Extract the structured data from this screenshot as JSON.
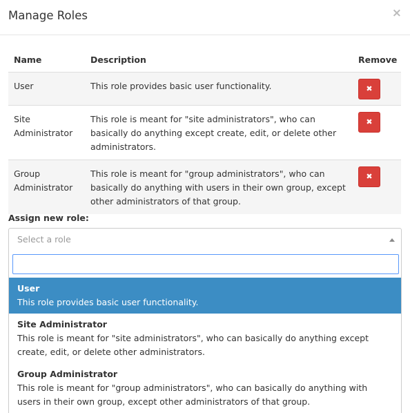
{
  "modal": {
    "title": "Manage Roles",
    "close_symbol": "×"
  },
  "table": {
    "headers": [
      "Name",
      "Description",
      "Remove"
    ],
    "rows": [
      {
        "name": "User",
        "description": "This role provides basic user functionality."
      },
      {
        "name": "Site Administrator",
        "description": "This role is meant for \"site administrators\", who can basically do anything except create, edit, or delete other administrators."
      },
      {
        "name": "Group Administrator",
        "description": "This role is meant for \"group administrators\", who can basically do anything with users in their own group, except other administrators of that group."
      }
    ],
    "remove_symbol": "✖"
  },
  "assign": {
    "label": "Assign new role:",
    "placeholder": "Select a role",
    "search_value": "",
    "options": [
      {
        "title": "User",
        "description": "This role provides basic user functionality."
      },
      {
        "title": "Site Administrator",
        "description": "This role is meant for \"site administrators\", who can basically do anything except create, edit, or delete other administrators."
      },
      {
        "title": "Group Administrator",
        "description": "This role is meant for \"group administrators\", who can basically do anything with users in their own group, except other administrators of that group."
      }
    ]
  },
  "colors": {
    "accent": "#3c8dc4",
    "danger": "#d9403a",
    "backdrop": "#3d3d3d"
  }
}
